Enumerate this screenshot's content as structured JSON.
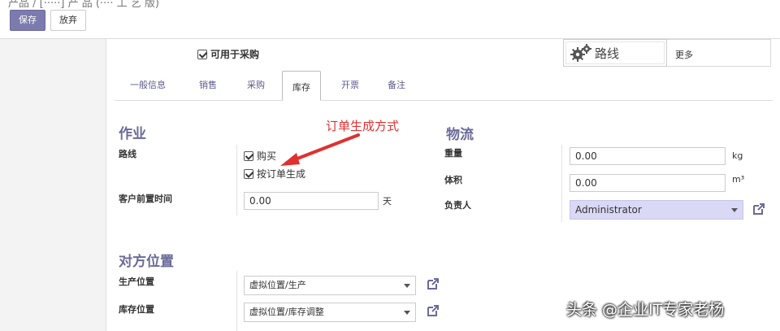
{
  "header": {
    "breadcrumb": "产品 / [·····] 产 品 (···· 工 艺 版)",
    "save_label": "保存",
    "discard_label": "放弃"
  },
  "form": {
    "purchasable_label": "可用于采购",
    "smart_buttons": {
      "routes_label": "路线",
      "more_label": "更多"
    },
    "tabs": [
      {
        "label": "一般信息",
        "active": false
      },
      {
        "label": "销售",
        "active": false
      },
      {
        "label": "采购",
        "active": false
      },
      {
        "label": "库存",
        "active": true
      },
      {
        "label": "开票",
        "active": false
      },
      {
        "label": "备注",
        "active": false
      }
    ],
    "operations": {
      "title": "作业",
      "routes_label": "路线",
      "routes": [
        {
          "label": "购买",
          "checked": true
        },
        {
          "label": "按订单生成",
          "checked": true
        }
      ],
      "lead_time_label": "客户前置时间",
      "lead_time_value": "0.00",
      "lead_time_unit": "天"
    },
    "logistics": {
      "title": "物流",
      "weight_label": "重量",
      "weight_value": "0.00",
      "weight_unit": "kg",
      "volume_label": "体积",
      "volume_value": "0.00",
      "volume_unit": "m³",
      "responsible_label": "负责人",
      "responsible_value": "Administrator"
    },
    "counterpart": {
      "title": "对方位置",
      "production_label": "生产位置",
      "production_value": "虚拟位置/生产",
      "inventory_label": "库存位置",
      "inventory_value": "虚拟位置/库存调整"
    }
  },
  "annotation": {
    "text": "订单生成方式",
    "color": "#e03030"
  },
  "watermark": "头条 @企业IT专家老杨",
  "colors": {
    "primary": "#7c7bad",
    "section_title": "#6a6a9a",
    "tab_text": "#5c5b8c",
    "highlight_select": "#d9d8f5"
  }
}
